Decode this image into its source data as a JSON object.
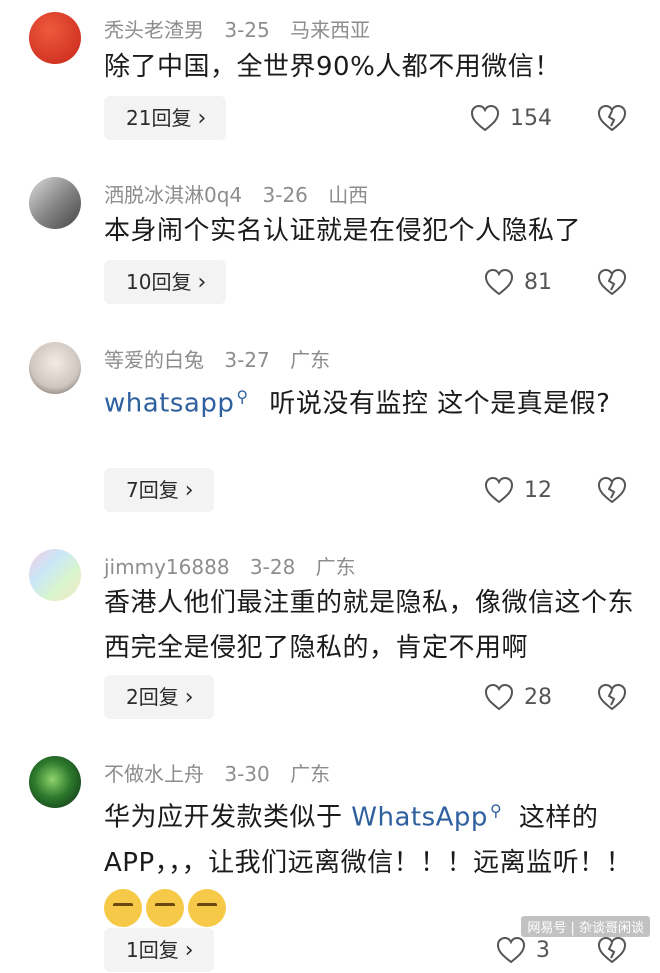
{
  "comments": [
    {
      "user": "秃头老渣男",
      "date": "3-25",
      "location": "马来西亚",
      "text": "除了中国，全世界90%人都不用微信！",
      "replies": "21回复",
      "likes": "154"
    },
    {
      "user": "洒脱冰淇淋0q4",
      "date": "3-26",
      "location": "山西",
      "text": "本身闹个实名认证就是在侵犯个人隐私了",
      "replies": "10回复",
      "likes": "81"
    },
    {
      "user": "等爱的白兔",
      "date": "3-27",
      "location": "广东",
      "link": "whatsapp",
      "text": "听说没有监控 这个是真是假?",
      "replies": "7回复",
      "likes": "12"
    },
    {
      "user": "jimmy16888",
      "date": "3-28",
      "location": "广东",
      "text": "香港人他们最注重的就是隐私，像微信这个东西完全是侵犯了隐私的，肯定不用啊",
      "replies": "2回复",
      "likes": "28"
    },
    {
      "user": "不做水上舟",
      "date": "3-30",
      "location": "广东",
      "text_before": "华为应开发款类似于",
      "link": "WhatsApp",
      "text_after": "这样的APP，，，让我们远离微信！！！远离监听！！",
      "replies": "1回复",
      "likes": "3"
    }
  ],
  "icons": {
    "like": "heart-outline-icon",
    "dislike": "broken-heart-icon",
    "search_mark": "search-icon"
  },
  "watermark": "网易号 | 杂谈哥闲谈"
}
